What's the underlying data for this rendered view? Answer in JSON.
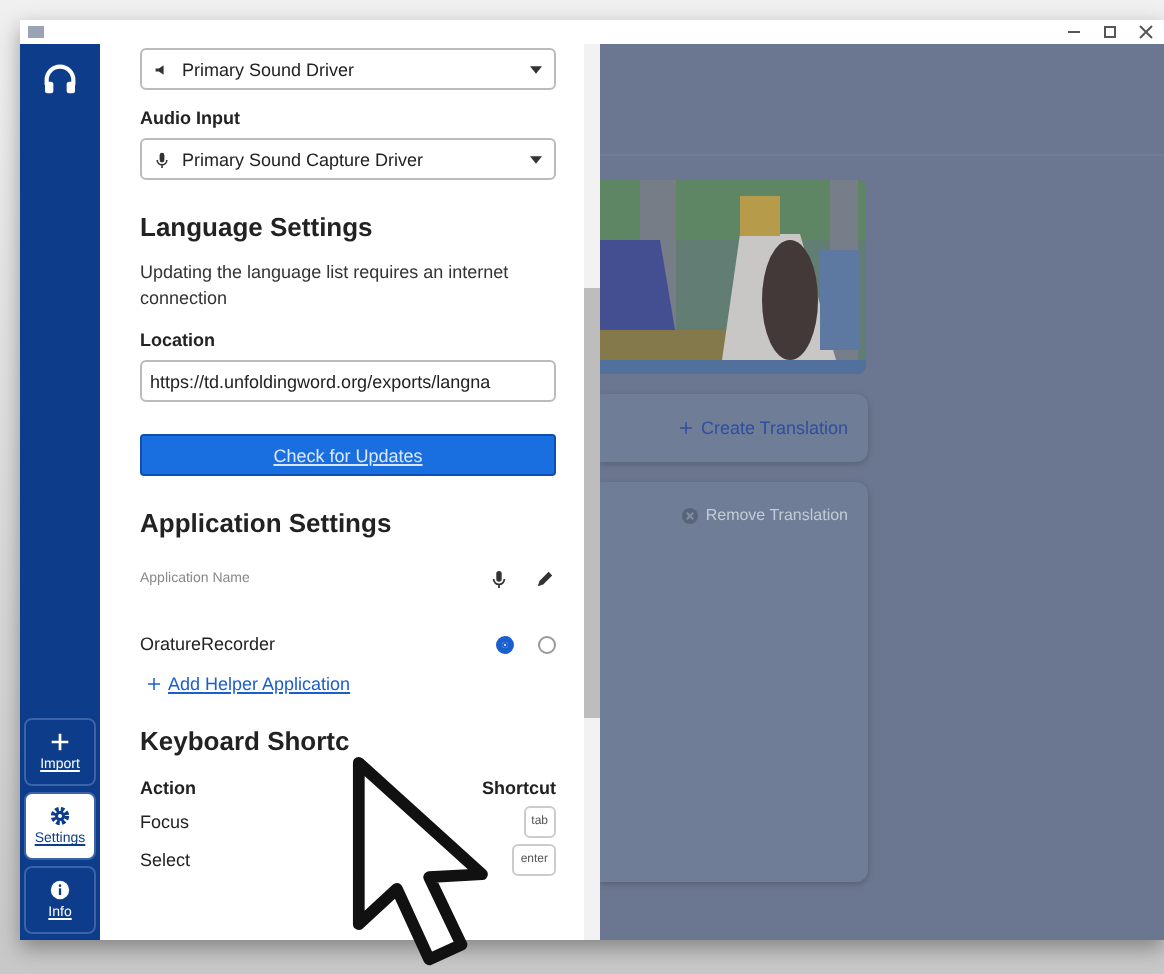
{
  "sidebar": {
    "items": [
      {
        "kind": "import",
        "label": "Import",
        "selected": false
      },
      {
        "kind": "settings",
        "label": "Settings",
        "selected": true
      },
      {
        "kind": "info",
        "label": "Info",
        "selected": false
      }
    ]
  },
  "settings": {
    "audio_output": {
      "value": "Primary Sound Driver"
    },
    "audio_input": {
      "label": "Audio Input",
      "value": "Primary Sound Capture Driver"
    },
    "language": {
      "heading": "Language Settings",
      "note": "Updating the language list requires an internet connection",
      "location_label": "Location",
      "location_value": "https://td.unfoldingword.org/exports/langna",
      "button": "Check for Updates"
    },
    "application": {
      "heading": "Application Settings",
      "column": "Application Name",
      "apps": [
        {
          "name": "OratureRecorder",
          "recorder": true,
          "editor": false
        }
      ],
      "add_link": "Add Helper Application"
    },
    "keyboard": {
      "heading": "Keyboard Shortc",
      "columns": [
        "Action",
        "Shortcut"
      ],
      "rows": [
        {
          "action": "Focus",
          "keys": [
            "tab"
          ]
        },
        {
          "action": "Select",
          "keys": [
            "enter"
          ]
        }
      ]
    }
  },
  "project": {
    "create": "Create Translation",
    "remove": "Remove Translation"
  }
}
